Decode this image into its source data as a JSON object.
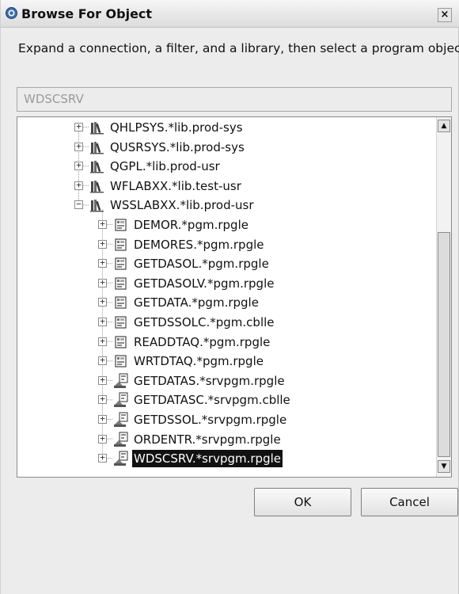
{
  "window": {
    "title": "Browse For Object",
    "close_glyph": "×"
  },
  "instruction": "Expand a connection, a filter, and a library, then select a program object.",
  "connection_field": {
    "value": "WDSCSRV"
  },
  "tree": {
    "libraries": [
      {
        "label": "QHLPSYS.*lib.prod-sys",
        "expander": "+",
        "icon": "library-icon"
      },
      {
        "label": "QUSRSYS.*lib.prod-sys",
        "expander": "+",
        "icon": "library-icon"
      },
      {
        "label": "QGPL.*lib.prod-usr",
        "expander": "+",
        "icon": "library-icon"
      },
      {
        "label": "WFLABXX.*lib.test-usr",
        "expander": "+",
        "icon": "library-icon"
      },
      {
        "label": "WSSLABXX.*lib.prod-usr",
        "expander": "−",
        "icon": "library-icon"
      }
    ],
    "objects": [
      {
        "label": "DEMOR.*pgm.rpgle",
        "expander": "+",
        "icon": "program-icon",
        "selected": false
      },
      {
        "label": "DEMORES.*pgm.rpgle",
        "expander": "+",
        "icon": "program-icon",
        "selected": false
      },
      {
        "label": "GETDASOL.*pgm.rpgle",
        "expander": "+",
        "icon": "program-icon",
        "selected": false
      },
      {
        "label": "GETDASOLV.*pgm.rpgle",
        "expander": "+",
        "icon": "program-icon",
        "selected": false
      },
      {
        "label": "GETDATA.*pgm.rpgle",
        "expander": "+",
        "icon": "program-icon",
        "selected": false
      },
      {
        "label": "GETDSSOLC.*pgm.cblle",
        "expander": "+",
        "icon": "program-icon",
        "selected": false
      },
      {
        "label": "READDTAQ.*pgm.rpgle",
        "expander": "+",
        "icon": "program-icon",
        "selected": false
      },
      {
        "label": "WRTDTAQ.*pgm.rpgle",
        "expander": "+",
        "icon": "program-icon",
        "selected": false
      },
      {
        "label": "GETDATAS.*srvpgm.rpgle",
        "expander": "+",
        "icon": "service-program-icon",
        "selected": false
      },
      {
        "label": "GETDATASC.*srvpgm.cblle",
        "expander": "+",
        "icon": "service-program-icon",
        "selected": false
      },
      {
        "label": "GETDSSOL.*srvpgm.rpgle",
        "expander": "+",
        "icon": "service-program-icon",
        "selected": false
      },
      {
        "label": "ORDENTR.*srvpgm.rpgle",
        "expander": "+",
        "icon": "service-program-icon",
        "selected": false
      },
      {
        "label": "WDSCSRV.*srvpgm.rpgle",
        "expander": "+",
        "icon": "service-program-icon",
        "selected": true
      }
    ]
  },
  "scrollbar": {
    "up_glyph": "▲",
    "down_glyph": "▼"
  },
  "buttons": {
    "ok_label": "OK",
    "cancel_label": "Cancel"
  },
  "colors": {
    "selection_bg": "#111111",
    "selection_fg": "#ffffff",
    "dialog_bg": "#ececec"
  }
}
